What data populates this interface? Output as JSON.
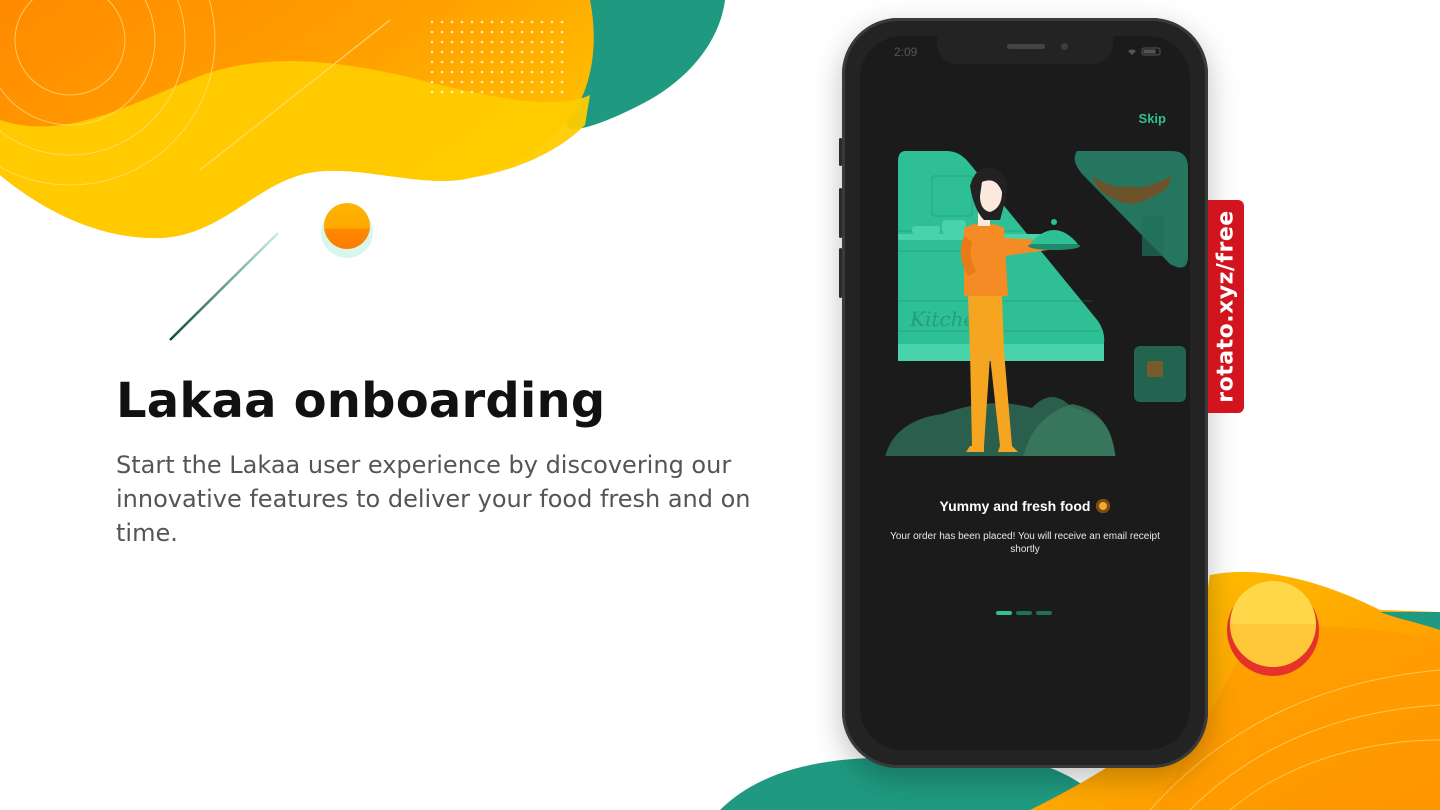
{
  "hero": {
    "title": "Lakaa onboarding",
    "description": "Start the Lakaa user experience by discovering our innovative features to deliver your food fresh and on time."
  },
  "phone": {
    "status_time": "2:09",
    "skip_label": "Skip",
    "onboarding": {
      "title": "Yummy and fresh food",
      "title_emoji": "pancake-emoji",
      "description": "Your order has been placed! You will receive an email receipt shortly",
      "page_count": 3,
      "current_page": 1
    }
  },
  "badge": {
    "text": "rotato.xyz/free"
  },
  "colors": {
    "accent_teal": "#2fbf95",
    "accent_orange": "#ff8a00",
    "accent_yellow": "#ffc800",
    "badge_red": "#d2141f",
    "screen_bg": "#1b1b1b"
  }
}
